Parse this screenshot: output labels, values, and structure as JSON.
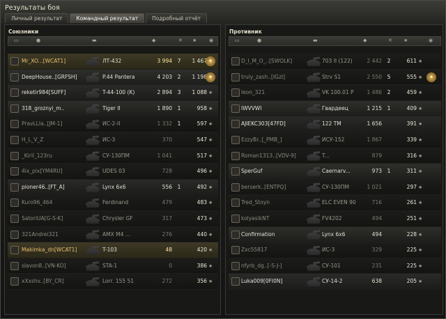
{
  "window": {
    "title": "Результаты боя"
  },
  "tabs": [
    "Личный результат",
    "Командный результат",
    "Подробный отчёт"
  ],
  "allies": {
    "title": "Союзники",
    "rows": [
      {
        "player": "Mr_XO...[WCAT1]",
        "vehicle": "ЛТ-432",
        "damage": "3 994",
        "frags": "7",
        "xp": "1 467",
        "medal": true,
        "style": "me"
      },
      {
        "player": "DeepHouse..[GRFSH]",
        "vehicle": "P.44 Pantera",
        "damage": "4 203",
        "frags": "2",
        "xp": "1 198",
        "medal": true,
        "style": "hl"
      },
      {
        "player": "reketir984[SUFF]",
        "vehicle": "T-44-100 (K)",
        "damage": "2 894",
        "frags": "3",
        "xp": "1 088",
        "medal": false,
        "style": "hl"
      },
      {
        "player": "318_groznyi_m..",
        "vehicle": "Tiger II",
        "damage": "1 890",
        "frags": "1",
        "xp": "958",
        "medal": false,
        "style": "hl"
      },
      {
        "player": "PravLLla..[JM-1]",
        "vehicle": "ИС-2-II",
        "damage": "1 332",
        "frags": "1",
        "xp": "597",
        "medal": false,
        "style": "dead"
      },
      {
        "player": "H_L_V_Z",
        "vehicle": "ИС-3",
        "damage": "370",
        "frags": "",
        "xp": "547",
        "medal": false,
        "style": "dead"
      },
      {
        "player": "_Kiril_123ru",
        "vehicle": "СУ-130ПМ",
        "damage": "1 041",
        "frags": "",
        "xp": "517",
        "medal": false,
        "style": "dead"
      },
      {
        "player": "4ix_pix[YM4RU]",
        "vehicle": "UDES 03",
        "damage": "728",
        "frags": "",
        "xp": "496",
        "medal": false,
        "style": "dead"
      },
      {
        "player": "pioner46..[FT_A]",
        "vehicle": "Lynx 6x6",
        "damage": "556",
        "frags": "1",
        "xp": "492",
        "medal": false,
        "style": "hl"
      },
      {
        "player": "Kuro96_464",
        "vehicle": "Ferdinand",
        "damage": "479",
        "frags": "",
        "xp": "483",
        "medal": false,
        "style": "dead"
      },
      {
        "player": "SatoriUA[G-S-K]",
        "vehicle": "Chrysler GF",
        "damage": "317",
        "frags": "",
        "xp": "473",
        "medal": false,
        "style": "dead"
      },
      {
        "player": "321Andrei321",
        "vehicle": "AMX M4 ...",
        "damage": "276",
        "frags": "",
        "xp": "440",
        "medal": false,
        "style": "dead"
      },
      {
        "player": "Makimka_dn[WCAT1]",
        "vehicle": "T-103",
        "damage": "48",
        "frags": "",
        "xp": "420",
        "medal": false,
        "style": "me"
      },
      {
        "player": "slavon8..[VN-KO]",
        "vehicle": "STA-1",
        "damage": "0",
        "frags": "",
        "xp": "386",
        "medal": false,
        "style": "dead"
      },
      {
        "player": "xXxshv..[BY_CR]",
        "vehicle": "Lorr. 155 51",
        "damage": "272",
        "frags": "",
        "xp": "356",
        "medal": false,
        "style": "dead"
      }
    ]
  },
  "enemies": {
    "title": "Противник",
    "rows": [
      {
        "player": "D_I_M_O_..[SWOLK]",
        "vehicle": "703 II (122)",
        "damage": "2 442",
        "frags": "2",
        "xp": "611",
        "medal": false,
        "style": "dead"
      },
      {
        "player": "truly_zash..[IGzI]",
        "vehicle": "Strv S1",
        "damage": "2 550",
        "frags": "5",
        "xp": "555",
        "medal": true,
        "style": "dead"
      },
      {
        "player": "leon_321",
        "vehicle": "VK 100.01 P",
        "damage": "1 486",
        "frags": "2",
        "xp": "459",
        "medal": false,
        "style": "dead"
      },
      {
        "player": "IWVVWI",
        "vehicle": "Гвардеец",
        "damage": "1 215",
        "frags": "1",
        "xp": "409",
        "medal": false,
        "style": "hl"
      },
      {
        "player": "AJIEKC303[47FD]",
        "vehicle": "122 TM",
        "damage": "1 656",
        "frags": "",
        "xp": "391",
        "medal": false,
        "style": "hl"
      },
      {
        "player": "EzzyBr..[_PMB_]",
        "vehicle": "ИСУ-152",
        "damage": "1 867",
        "frags": "",
        "xp": "339",
        "medal": false,
        "style": "dead"
      },
      {
        "player": "Roman1313..[VDV-9]",
        "vehicle": "T...",
        "damage": "879",
        "frags": "",
        "xp": "316",
        "medal": false,
        "style": "dead"
      },
      {
        "player": "SperGuf",
        "vehicle": "Caernarv...",
        "damage": "973",
        "frags": "1",
        "xp": "311",
        "medal": false,
        "style": "hl"
      },
      {
        "player": "berserk..[ENTPQ]",
        "vehicle": "СУ-130ПМ",
        "damage": "1 021",
        "frags": "",
        "xp": "297",
        "medal": false,
        "style": "dead"
      },
      {
        "player": "Tred_Stoyn",
        "vehicle": "ELC EVEN 90",
        "damage": "716",
        "frags": "",
        "xp": "261",
        "medal": false,
        "style": "dead"
      },
      {
        "player": "kolyasikNT",
        "vehicle": "FV4202",
        "damage": "494",
        "frags": "",
        "xp": "251",
        "medal": false,
        "style": "dead"
      },
      {
        "player": "Confirmation",
        "vehicle": "Lynx 6x6",
        "damage": "494",
        "frags": "",
        "xp": "228",
        "medal": false,
        "style": "hl"
      },
      {
        "player": "Zxc55817",
        "vehicle": "ИС-3",
        "damage": "329",
        "frags": "",
        "xp": "225",
        "medal": false,
        "style": "dead"
      },
      {
        "player": "nfyrb_dg..[-S-J-]",
        "vehicle": "СУ-101",
        "damage": "231",
        "frags": "",
        "xp": "225",
        "medal": false,
        "style": "dead"
      },
      {
        "player": "Luka009[0FI0N]",
        "vehicle": "СУ-14-2",
        "damage": "638",
        "frags": "",
        "xp": "205",
        "medal": false,
        "style": "hl"
      }
    ]
  }
}
